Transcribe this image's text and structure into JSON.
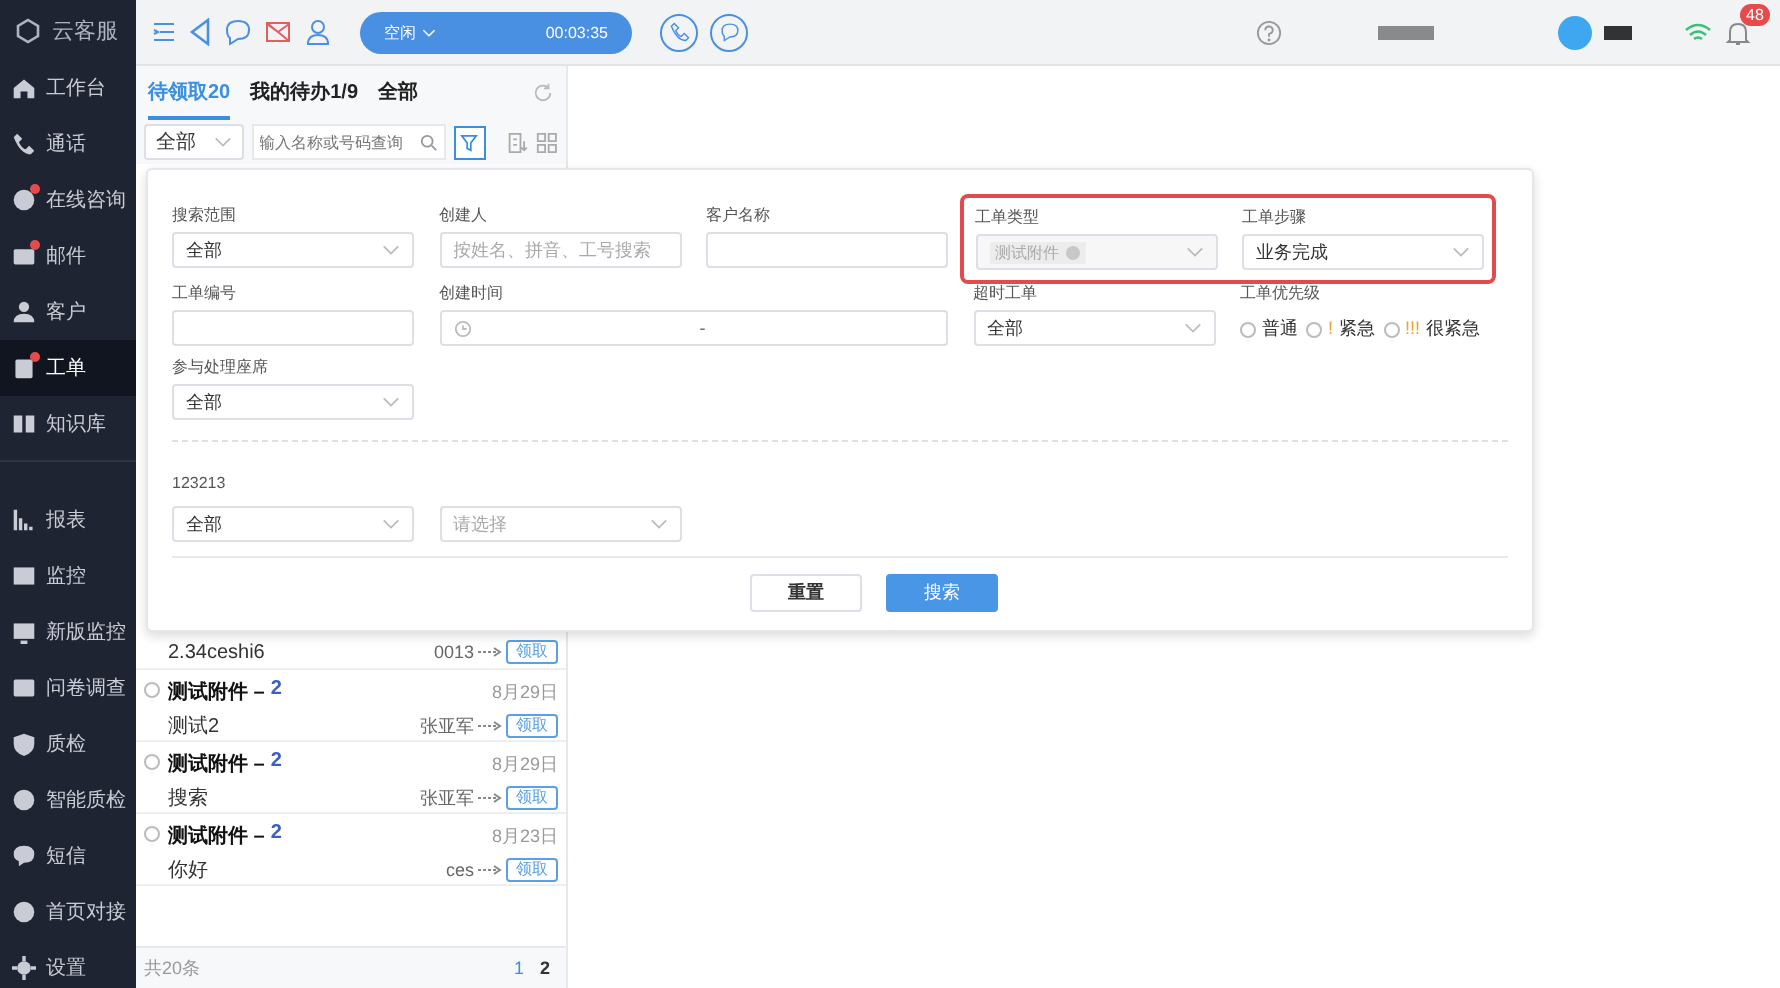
{
  "sidebar": {
    "logo": "云客服",
    "sections": [
      {
        "items": [
          {
            "label": "工作台",
            "badge": false,
            "selected": false
          },
          {
            "label": "通话",
            "badge": false,
            "selected": false
          },
          {
            "label": "在线咨询",
            "badge": true,
            "selected": false
          },
          {
            "label": "邮件",
            "badge": true,
            "selected": false
          },
          {
            "label": "客户",
            "badge": false,
            "selected": false
          },
          {
            "label": "工单",
            "badge": true,
            "selected": true
          },
          {
            "label": "知识库",
            "badge": false,
            "selected": false
          }
        ]
      },
      {
        "items": [
          {
            "label": "报表",
            "badge": false,
            "selected": false
          },
          {
            "label": "监控",
            "badge": false,
            "selected": false
          },
          {
            "label": "新版监控",
            "badge": false,
            "selected": false
          },
          {
            "label": "问卷调查",
            "badge": false,
            "selected": false
          },
          {
            "label": "质检",
            "badge": false,
            "selected": false
          },
          {
            "label": "智能质检",
            "badge": false,
            "selected": false
          },
          {
            "label": "短信",
            "badge": false,
            "selected": false
          },
          {
            "label": "首页对接",
            "badge": false,
            "selected": false
          },
          {
            "label": "设置",
            "badge": false,
            "selected": false
          }
        ]
      }
    ]
  },
  "topbar": {
    "status": "空闲",
    "timer": "00:03:35",
    "notifications": "48"
  },
  "list": {
    "tabs": [
      {
        "label": "待领取20",
        "selected": true
      },
      {
        "label": "我的待办1/9",
        "selected": false
      },
      {
        "label": "全部",
        "selected": false
      }
    ],
    "scope": "全部",
    "search": {
      "placeholder": "输入名称或号码查询"
    },
    "rows": [
      {
        "subtitle": "2.34ceshi6",
        "assignee": "0013",
        "claim": "领取"
      },
      {
        "selected": false,
        "title": "测试附件 –",
        "count": "2",
        "date": "8月29日",
        "subtitle": "测试2",
        "assignee": "张亚军",
        "claim": "领取"
      },
      {
        "selected": false,
        "title": "测试附件 –",
        "count": "2",
        "date": "8月29日",
        "subtitle": "搜索",
        "assignee": "张亚军",
        "claim": "领取"
      },
      {
        "selected": false,
        "title": "测试附件 –",
        "count": "2",
        "date": "8月23日",
        "subtitle": "你好",
        "assignee": "ces",
        "claim": "领取"
      }
    ],
    "total": "共20条",
    "pages": [
      {
        "label": "1",
        "selected": true
      },
      {
        "label": "2",
        "selected": false
      }
    ]
  },
  "filter": {
    "fields": [
      {
        "kind": "select",
        "label": "搜索范围",
        "value": "全部"
      },
      {
        "kind": "input",
        "label": "创建人",
        "placeholder": "按姓名、拼音、工号搜索"
      },
      {
        "kind": "input",
        "label": "客户名称"
      },
      {
        "kind": "group",
        "highlighted": true,
        "fields": [
          {
            "kind": "tags",
            "label": "工单类型",
            "tags": [
              "测试附件"
            ]
          },
          {
            "kind": "select",
            "label": "工单步骤",
            "value": "业务完成"
          }
        ]
      },
      {
        "kind": "input",
        "label": "工单编号"
      },
      {
        "kind": "daterange",
        "label": "创建时间",
        "separator": "-"
      },
      {
        "kind": "select",
        "label": "超时工单",
        "value": "全部"
      },
      {
        "kind": "radios",
        "label": "工单优先级",
        "options": [
          {
            "label": "普通",
            "selected": false
          },
          {
            "mark": "!",
            "label": "紧急",
            "selected": false
          },
          {
            "mark": "!!!",
            "label": "很紧急",
            "selected": false
          }
        ]
      },
      {
        "kind": "select",
        "label": "参与处理座席",
        "value": "全部"
      }
    ],
    "custom": {
      "label": "123213",
      "fields": [
        {
          "kind": "select",
          "value": "全部"
        },
        {
          "kind": "select",
          "placeholder": "请选择"
        }
      ]
    },
    "buttons": [
      {
        "label": "重置",
        "primary": false
      },
      {
        "label": "搜索",
        "primary": true
      }
    ]
  }
}
